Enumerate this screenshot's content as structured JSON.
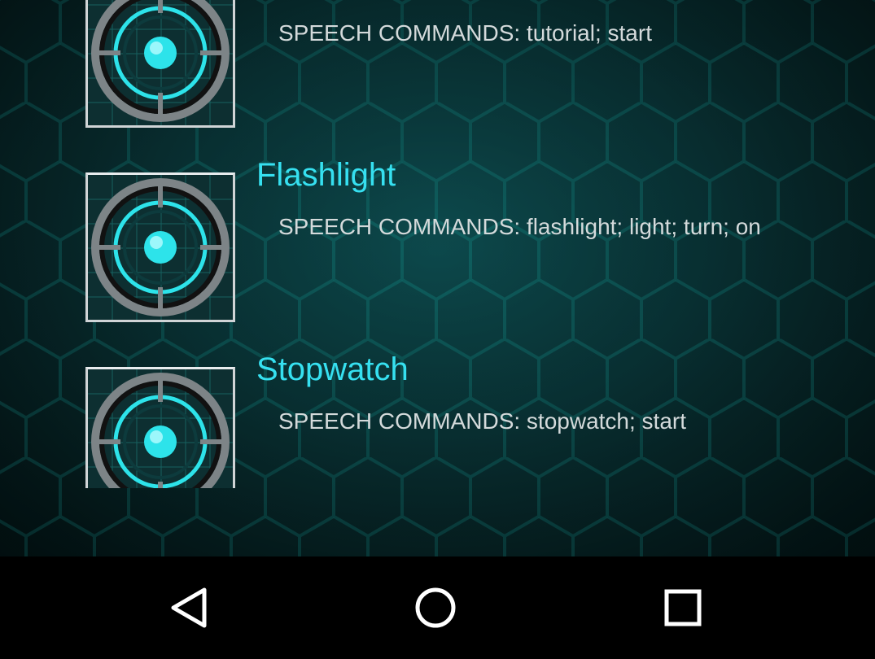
{
  "items": [
    {
      "title": "",
      "commands": "SPEECH COMMANDS: tutorial; start",
      "icon": "radar-target-icon"
    },
    {
      "title": "Flashlight",
      "commands": "SPEECH COMMANDS: flashlight; light; turn; on",
      "icon": "radar-target-icon"
    },
    {
      "title": "Stopwatch",
      "commands": "SPEECH COMMANDS: stopwatch; start",
      "icon": "radar-target-icon"
    }
  ],
  "nav": {
    "back_icon": "back-triangle-icon",
    "home_icon": "home-circle-icon",
    "recents_icon": "recents-square-icon"
  },
  "colors": {
    "title": "#36e0f0",
    "subtitle": "#d4dadb",
    "background": "#0a3a3d",
    "hex_lines": "#0f6b6a",
    "navbar": "#000000"
  }
}
